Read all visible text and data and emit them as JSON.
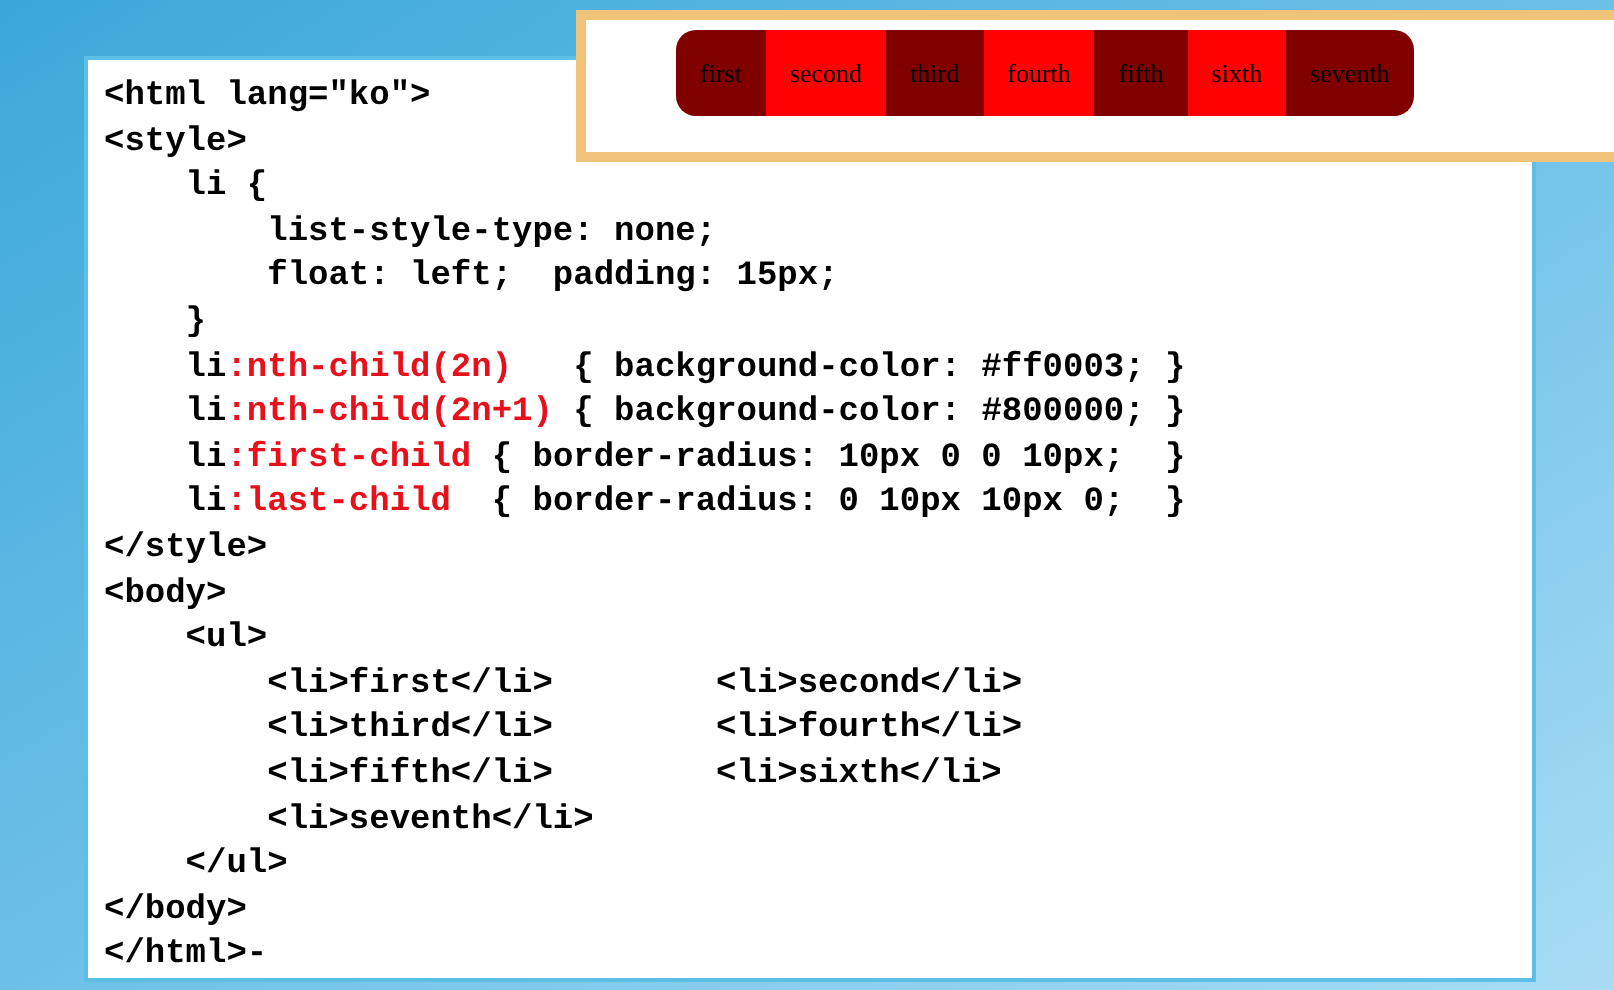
{
  "code_lines": [
    [
      {
        "kind": "plain",
        "text": "<html lang=\"ko\">"
      }
    ],
    [
      {
        "kind": "plain",
        "text": "<style>"
      }
    ],
    [
      {
        "kind": "plain",
        "text": "    li {"
      }
    ],
    [
      {
        "kind": "plain",
        "text": "        list-style-type: none;"
      }
    ],
    [
      {
        "kind": "plain",
        "text": "        float: left;  padding: 15px;"
      }
    ],
    [
      {
        "kind": "plain",
        "text": "    }"
      }
    ],
    [
      {
        "kind": "plain",
        "text": "    li"
      },
      {
        "kind": "selector",
        "text": ":nth-child(2n)"
      },
      {
        "kind": "plain",
        "text": "   { background-color: #ff0003; }"
      }
    ],
    [
      {
        "kind": "plain",
        "text": "    li"
      },
      {
        "kind": "selector",
        "text": ":nth-child(2n+1)"
      },
      {
        "kind": "plain",
        "text": " { background-color: #800000; }"
      }
    ],
    [
      {
        "kind": "plain",
        "text": "    li"
      },
      {
        "kind": "selector",
        "text": ":first-child"
      },
      {
        "kind": "plain",
        "text": " { border-radius: 10px 0 0 10px;  }"
      }
    ],
    [
      {
        "kind": "plain",
        "text": "    li"
      },
      {
        "kind": "selector",
        "text": ":last-child"
      },
      {
        "kind": "plain",
        "text": "  { border-radius: 0 10px 10px 0;  }"
      }
    ],
    [
      {
        "kind": "plain",
        "text": "</style>"
      }
    ],
    [
      {
        "kind": "plain",
        "text": "<body>"
      }
    ],
    [
      {
        "kind": "plain",
        "text": "    <ul>"
      }
    ],
    [
      {
        "kind": "plain",
        "text": "        <li>first</li>        <li>second</li>"
      }
    ],
    [
      {
        "kind": "plain",
        "text": "        <li>third</li>        <li>fourth</li>"
      }
    ],
    [
      {
        "kind": "plain",
        "text": "        <li>fifth</li>        <li>sixth</li>"
      }
    ],
    [
      {
        "kind": "plain",
        "text": "        <li>seventh</li>"
      }
    ],
    [
      {
        "kind": "plain",
        "text": "    </ul>"
      }
    ],
    [
      {
        "kind": "plain",
        "text": "</body>"
      }
    ],
    [
      {
        "kind": "plain",
        "text": "</html>-"
      }
    ]
  ],
  "preview": {
    "items": [
      {
        "label": "first",
        "color": "#800000"
      },
      {
        "label": "second",
        "color": "#ff0003"
      },
      {
        "label": "third",
        "color": "#800000"
      },
      {
        "label": "fourth",
        "color": "#ff0003"
      },
      {
        "label": "fifth",
        "color": "#800000"
      },
      {
        "label": "sixth",
        "color": "#ff0003"
      },
      {
        "label": "seventh",
        "color": "#800000"
      }
    ]
  }
}
